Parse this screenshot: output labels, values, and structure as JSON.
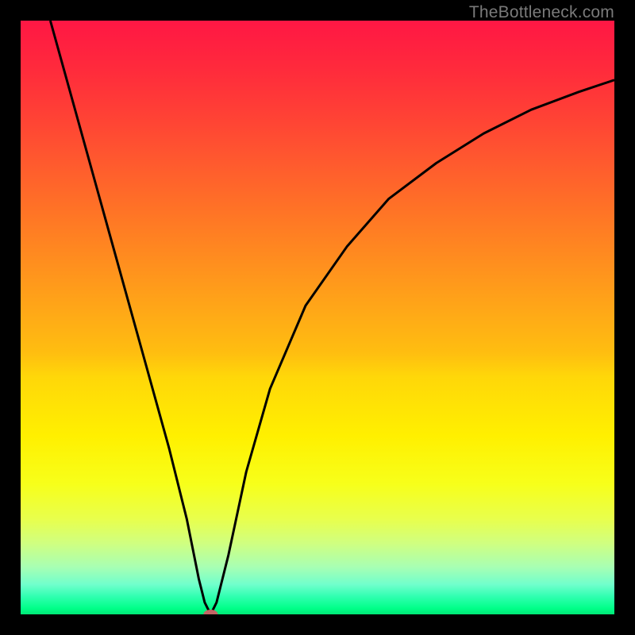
{
  "watermark": "TheBottleneck.com",
  "chart_data": {
    "type": "line",
    "title": "",
    "xlabel": "",
    "ylabel": "",
    "xlim": [
      0,
      100
    ],
    "ylim": [
      0,
      100
    ],
    "series": [
      {
        "name": "bottleneck-curve",
        "x": [
          5,
          10,
          15,
          20,
          25,
          28,
          30,
          31,
          32,
          33,
          35,
          38,
          42,
          48,
          55,
          62,
          70,
          78,
          86,
          94,
          100
        ],
        "y": [
          100,
          82,
          64,
          46,
          28,
          16,
          6,
          2,
          0,
          2,
          10,
          24,
          38,
          52,
          62,
          70,
          76,
          81,
          85,
          88,
          90
        ]
      }
    ],
    "annotations": [
      {
        "name": "minimum-marker",
        "x": 32,
        "y": 0
      }
    ],
    "grid": false,
    "legend": false,
    "colors": {
      "curve": "#000000",
      "gradient_top": "#ff1744",
      "gradient_bottom": "#00e676",
      "marker": "#c26565"
    }
  }
}
